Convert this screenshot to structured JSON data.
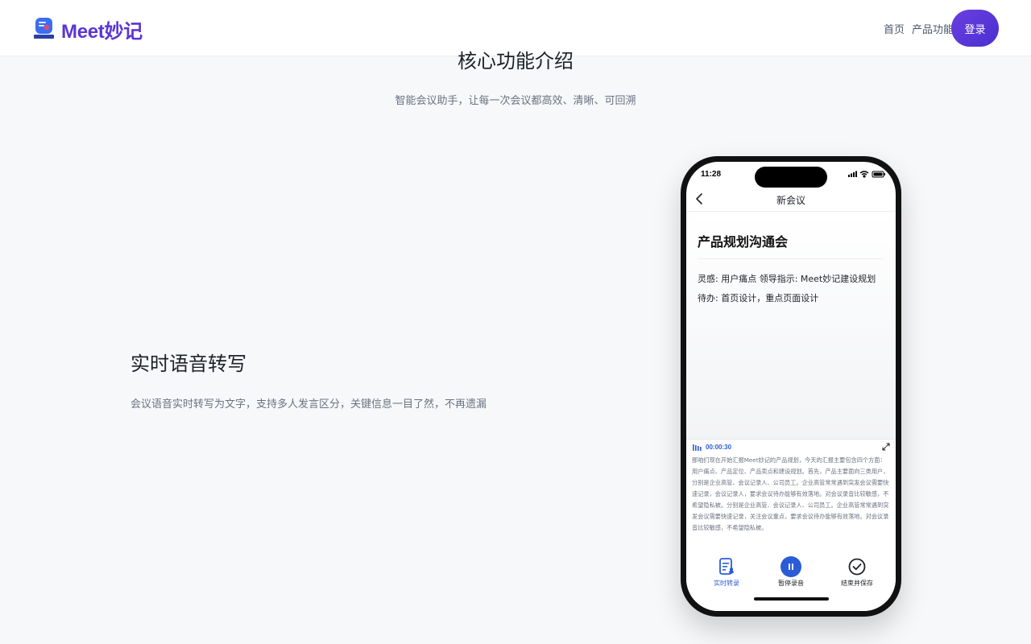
{
  "header": {
    "brand": "Meet妙记",
    "nav": [
      "首页",
      "产品功能"
    ],
    "cta_label": "登录"
  },
  "section": {
    "title": "核心功能介绍",
    "subtitle": "智能会议助手，让每一次会议都高效、清晰、可回溯"
  },
  "feature": {
    "title": "实时语音转写",
    "description": "会议语音实时转写为文字，支持多人发言区分，关键信息一目了然，不再遗漏"
  },
  "phone": {
    "time": "11:28",
    "nav_title": "新会议",
    "note_title": "产品规划沟通会",
    "note_row1": "灵感: 用户痛点   领导指示: Meet妙记建设规划",
    "note_row2": "待办: 首页设计，重点页面设计",
    "rec_time": "00:00:30",
    "transcript": "那咱们现在开始汇报Meet妙记的产品规划，今天的汇报主要包含四个方面：用户痛点、产品定位、产品卖点和建设规划。首先，产品主要面向三类用户，分别是企业高管、会议记录人、公司员工。企业高管常常遇到突发会议需要快速记录，会议记录人，要求会议待办能够有效落地。对会议录音比较敏感，不希望隐私被。分别是企业高管、会议记录人、公司员工。企业高管常常遇到突发会议需要快速记录，关注会议重点，要求会议待办能够有效落地。对会议录音比较敏感，不希望隐私被。",
    "tools": [
      "实时转录",
      "暂停录音",
      "结束并保存"
    ]
  },
  "colors": {
    "brand": "#5b35d5",
    "accent_blue": "#2b5bd7",
    "cta_gradient_start": "#6b3fe0",
    "cta_gradient_end": "#4a2fd0"
  },
  "icons": [
    "logo-icon",
    "back-icon",
    "signal-icon",
    "wifi-icon",
    "battery-icon",
    "waveform-icon",
    "expand-icon",
    "transcribe-icon",
    "pause-icon",
    "check-circle-icon"
  ]
}
